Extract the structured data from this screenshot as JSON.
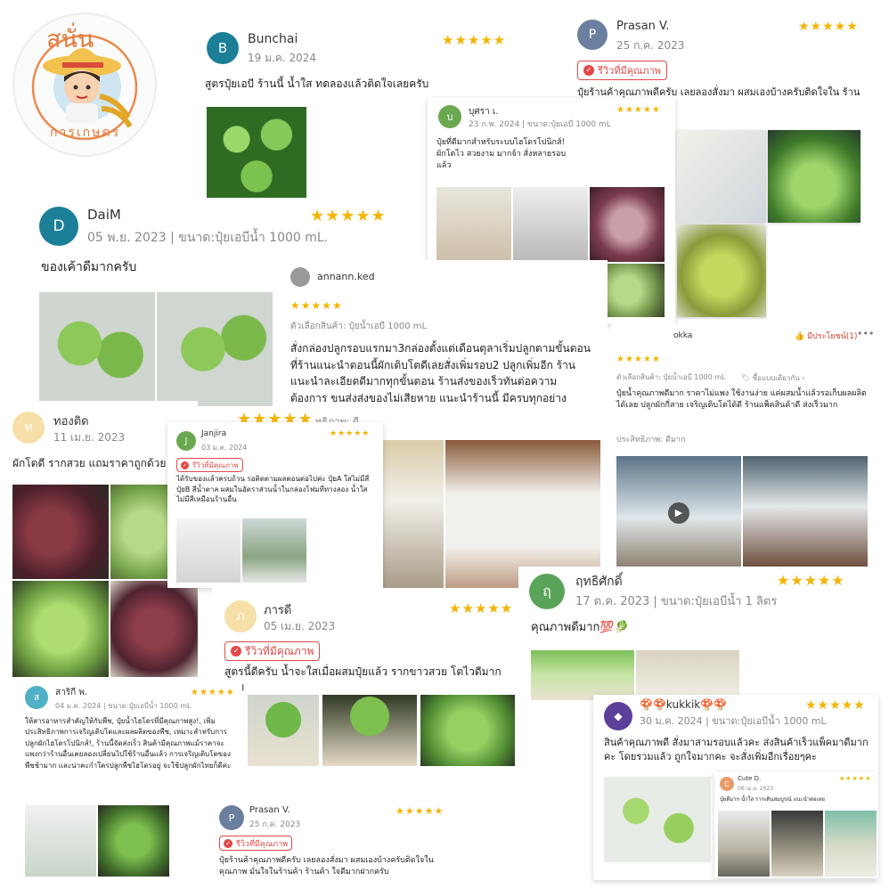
{
  "colors": {
    "star": "#f5b400",
    "badge": "#e24848",
    "teal": "#1a7f97"
  },
  "logo": {
    "top_text": "สนั่น",
    "bottom_text": "การเกษตร"
  },
  "star_glyphs": "★★★★★",
  "quality_badge": "รีวิวที่มีคุณภาพ",
  "c1": {
    "initial": "B",
    "name": "Bunchai",
    "date": "19 ม.ค. 2024",
    "text": "สูตรปุ๋ยเอบี ร้านนี้ น้ำใส ทดลองแล้วติดใจเลยครับ"
  },
  "c2": {
    "initial": "P",
    "name": "Prasan V.",
    "date": "25 ก.ค. 2023",
    "text": "ปุ๋ยร้านค้าคุณภาพดีครับ เลยลองสั่งมา ผสมเองบ้างครับติดใจใน ร้านค้า ใจดีมากฝากครับ"
  },
  "c3": {
    "initial": "บ",
    "name": "บุศรา เ.",
    "date": "23 ก.พ. 2024 | ขนาด:ปุ๋ยเอบี 1000 mL",
    "text": "ปุ๋ยที่ดีมากสำหรับระบบไฮโดรโปนิกส์! ผักโตไว สวยงาม มากจ้า สั่งหลายรอบแล้ว"
  },
  "c4": {
    "initial": "D",
    "name": "DaiM",
    "date": "05 พ.ย. 2023 | ขนาด:ปุ๋ยเอบีน้ำ 1000 mL.",
    "text": "ของเค้าดีมากครับ"
  },
  "c5": {
    "name": "annann.ked",
    "option": "ตัวเลือกสินค้า: ปุ๋ยน้ำเอบี 1000 mL",
    "text": "สั่งกล่องปลูกรอบแรกมา3กล่องตั้งแต่เดือนตุลาเริ่มปลูกตามขั้นตอนที่ร้านแนะนำตอนนี้ผักเติบโตดีเลยสั่งเพิ่มรอบ2 ปลูกเพิ่มอีก ร้านแนะนำละเอียดดีมากทุกขั้นตอน ร้านส่งของเร็วทันต่อความต้องการ ขนส่งส่งของไม่เสียหาย แนะนำร้านนี้ มีครบทุกอย่าง",
    "effect": "ทธิภาพ: ดี"
  },
  "c6": {
    "name": "okka",
    "helpful": "มีประโยชน์(1)",
    "option": "ตัวเลือกสินค้า: ปุ๋ยน้ำเอบี 1000 mL",
    "similar": "ซื้อแบบเดียวกัน",
    "text": "ปุ๋ยน้ำคุณภาพดีมาก ราคาไม่แพง ใช้งานง่าย แค่ผสมน้ำแล้วรอเก็บผลผลิตได้เลย ปลูกผักกี่สาย เจริญเติบโตได้ดี ร้านแพ็คสินค้าดี ส่งเร็วมาก",
    "effect": "ประสิทธิภาพ: ดีมาก"
  },
  "c7": {
    "initial": "ท",
    "name": "ทองติด",
    "date": "11 เม.ย. 2023",
    "text": "ผักโตดี รากสวย แถมราคาถูกด้วย"
  },
  "c8": {
    "initial": "J",
    "name": "Janjira",
    "date": "03 ม.ค. 2024",
    "text": "ได้รับของแล้วครบถ้วน รอติดตามผลตอนต่อไปค่ะ ปุ๋ยA ใสไม่มีสี ปุ๋ยB สีน้ำตาล ผสมในอัตราส่วนน้ำในกล่องโฟมที่ทางลอง น้ำใสไม่มีสีเหมือนร้านอื่น"
  },
  "c9": {
    "initial": "ฤ",
    "name": "ฤทธิศักดิ์",
    "date": "17 ต.ค. 2023 | ขนาด:ปุ๋ยเอบีน้ำ 1 ลิตร",
    "text": "คุณภาพดีมาก💯🥬"
  },
  "c10": {
    "initial": "ภ",
    "name": "ภารดี",
    "date": "05 เม.ย. 2023",
    "text": "สูตรนี้ดีครับ น้ำจะใสเมื่อผสมปุ๋ยแล้ว รากขาวสวย โตไวดีมากครับ"
  },
  "c11": {
    "initial": "ส",
    "name": "สาริกี พ.",
    "date": "04 ม.ค. 2024 | ขนาด:ปุ๋ยเอบีน้ำ 1000 mL",
    "text": "ให้สารอาหารสำคัญให้กับพืช, ปุ๋ยน้ำไฮโดรที่มีคุณภาพสูง!, เพิ่มประสิทธิภาพการเจริญเติบโตและผลผลิตของพืช, เหมาะสำหรับการปลูกผักไฮโดรโปนิกส์!, ร้านนี้จัดส่งเร็ว สินค้ามีคุณภาพแม้ราคาจะแพงกว่าร้านอื่นเคยลองเปลี่ยนไปใช้ร้านอื่นแล้ว การเจริญเติบโตของพืชช้ามาก และน่าคะกำใครปลูกพืชไฮโดรอยู่ จะใช้ปลูกผักไทยก็ดีค่ะ"
  },
  "c12": {
    "initial": "P",
    "name": "Prasan V.",
    "date": "25 ก.ค. 2023",
    "text": "ปุ๋ยร้านค้าคุณภาพดีครับ เลยลองสั่งมา ผสมเองบ้างครับติดใจใน คุณภาพ มั่นใจในร้านค้า ร้านค้า ใจดีมากฝากครับ"
  },
  "c13": {
    "initial": "◆",
    "name": "🍄🍄kukkik🍄🍄",
    "date": "30 ม.ค. 2024 | ขนาด:ปุ๋ยเอบีน้ำ 1000 mL",
    "text": "สินค้าคุณภาพดี สั่งมาสามรอบแล้วคะ ส่งสินค้าเร็วแพ็คมาดีมากคะ โดยรวมแล้ว ถูกใจมากคะ จะสั่งเพิ่มอีกเรื่อยๆคะ"
  },
  "c14": {
    "initial": "C",
    "name": "Cute D.",
    "date": "06 เม.ย. 2023",
    "text": "ปุ๋ยดีมาก น้ำใส รากเดินสมบูรณ์ แนะนำต่อเลย"
  }
}
